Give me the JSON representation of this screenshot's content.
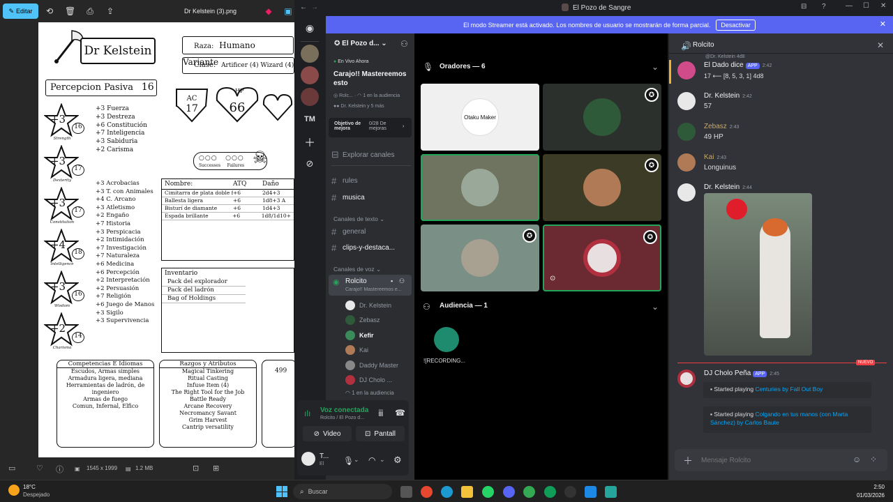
{
  "photos": {
    "edit_label": "Editar",
    "file_name": "Dr Kelstein (3).png",
    "dimensions": "1545 x 1999",
    "file_size": "1.2 MB"
  },
  "sheet": {
    "name": "Dr Kelstein",
    "race_label": "Raza:",
    "race": "Humano Variante",
    "class_label": "Clase:",
    "class": "Artificer (4) Wizard (4)",
    "passive_label": "Percepcion Pasiva",
    "passive_value": "16",
    "ac_label": "AC",
    "ac": "17",
    "hp_label": "HP",
    "hp": "66",
    "successes": "Successes",
    "failures": "Failures",
    "abilities": [
      {
        "mod": "+3",
        "score": "16",
        "name": "Strength"
      },
      {
        "mod": "+3",
        "score": "17",
        "name": "Dexterity"
      },
      {
        "mod": "+3",
        "score": "17",
        "name": "Constitution"
      },
      {
        "mod": "+4",
        "score": "18",
        "name": "Intelligence"
      },
      {
        "mod": "+3",
        "score": "16",
        "name": "Wisdom"
      },
      {
        "mod": "+2",
        "score": "14",
        "name": "Charisma"
      }
    ],
    "saves": [
      "+3 Fuerza",
      "+3 Destreza",
      "+6 Constitución",
      "+7 Inteligencia",
      "+3 Sabiduria",
      "+2 Carisma"
    ],
    "skills": [
      "+3 Acrobacias",
      "+3 T. con Animales",
      "+4 C. Arcano",
      "+3 Atletismo",
      "+2 Engaño",
      "+7 Historia",
      "+3 Perspicacia",
      "+2 Intimidación",
      "+7 Investigación",
      "+7 Naturaleza",
      "+6 Medicina",
      "+6 Percepción",
      "+2 Interpretación",
      "+2 Persuasión",
      "+7 Religión",
      "+6 Juego de Manos",
      "+3 Sigilo",
      "+3 Supervivencia"
    ],
    "weapons_header": [
      "Nombre:",
      "ATQ",
      "Daño"
    ],
    "weapons": [
      [
        "Cimitarra de plata doble filo",
        "+6",
        "2d4+3"
      ],
      [
        "Ballesta ligera",
        "+6",
        "1d8+3 A"
      ],
      [
        "Bisturí de diamante",
        "+6",
        "1d4+3"
      ],
      [
        "Espada brillante",
        "+6",
        "1d8/1d10+"
      ]
    ],
    "inventory_title": "Inventario",
    "inventory": [
      "Pack del explorador",
      "Pack del ladrón",
      "Bag of Holdings"
    ],
    "prof_title": "Competencias E Idiomas",
    "prof": [
      "Escudos, Armas simples",
      "Armadura ligera, mediana",
      "Herramientas de ladrón, de",
      "ingeniero",
      "Armas de fuego",
      "Comun, Infernal, Elfico"
    ],
    "traits_title": "Razgos y Atributos",
    "traits": [
      "Magical Tinkering",
      "Ritual Casting",
      "Infuse Item (4)",
      "The Right Tool for the Job",
      "Battle Ready",
      "Arcane Recovery",
      "Necromancy Savant",
      "Grim Harvest",
      "Cantrip versatility"
    ],
    "gold": "499"
  },
  "discord": {
    "window_title": "El Pozo de Sangre",
    "banner_text": "El modo Streamer está activado. Los nombres de usuario se mostrarán de forma parcial.",
    "banner_button": "Desactivar",
    "server_name": "El Pozo d...",
    "live_label": "En Vivo Ahora",
    "event_title": "Carajo!! Mastereemos esto",
    "event_host": "Rolc...",
    "event_audience": "1 en la audiencia",
    "event_people": "Dr. Kelstein y 5 más",
    "boost_label": "Objetivo de mejora",
    "boost_progress": "0/28 De mejoras",
    "explore_label": "Explorar canales",
    "channels_top": [
      "rules",
      "musica"
    ],
    "text_category": "Canales de texto",
    "text_channels": [
      "general",
      "clips-y-destaca..."
    ],
    "voice_category": "Canales de voz",
    "voice_channel": "Rolcito",
    "voice_channel_sub": "Carajo!! Mastereemos e...",
    "voice_users": [
      "Dr. Kelstein",
      "Zebasz",
      "Kefir",
      "Kai",
      "Daddy Master",
      "DJ Cholo ..."
    ],
    "voice_audience": "1 en la audiencia",
    "voice_connected": "Voz conectada",
    "voice_connected_sub": "Rolcito / El Pozo d...",
    "video_btn": "Video",
    "screen_btn": "Pantall",
    "user_name": "T...",
    "user_status": "El",
    "rail_server": "TM",
    "speakers_header": "Oradores — 6",
    "audience_header": "Audiencia — 1",
    "audience_user": "![RECORDING...",
    "tile_logo": "Otaku Maker",
    "chat_channel": "Rolcito",
    "messages": [
      {
        "name": "El Dado dice",
        "app": "APP",
        "time": "2:42",
        "text": "17  ⟵ [8, 5, 3, 1] 4d8"
      },
      {
        "name": "Dr. Kelstein",
        "time": "2:42",
        "text": "57"
      },
      {
        "name": "Zebasz",
        "time": "2:43",
        "text": "49 HP"
      },
      {
        "name": "Kai",
        "time": "2:43",
        "text": "Longuinus"
      },
      {
        "name": "Dr. Kelstein",
        "time": "2:44",
        "text": ""
      },
      {
        "name": "DJ Cholo Peña",
        "app": "APP",
        "time": "2:45",
        "text": ""
      }
    ],
    "new_label": "NUEVO",
    "embed1_prefix": "Started playing",
    "embed1_song": "Centuries by Fall Out Boy",
    "embed2_prefix": "Started playing",
    "embed2_song": "Colgando en tus manos (con Marta Sánchez) by Carlos Baute",
    "chat_placeholder": "Mensaje Rolcito",
    "replied_to": "@Dr. Kelstein 4d8"
  },
  "taskbar": {
    "weather_temp": "18°C",
    "weather_desc": "Despejado",
    "search_placeholder": "Buscar",
    "time": "2:50",
    "date": "01/03/2026"
  },
  "colors": {
    "blurple": "#5865f2",
    "editar": "#4fc3f7",
    "new_red": "#f23f43",
    "link": "#00a8fc"
  }
}
